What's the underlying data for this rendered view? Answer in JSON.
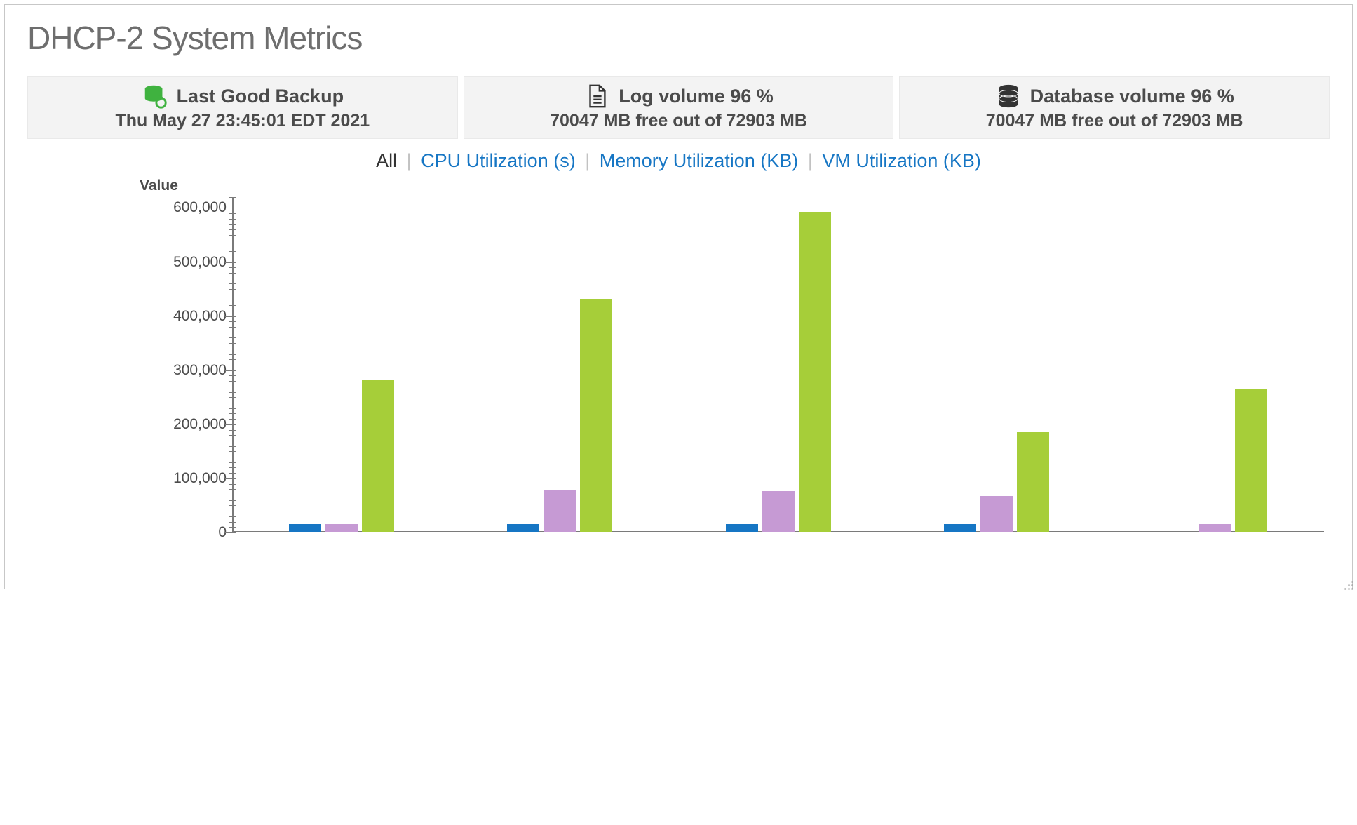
{
  "title": "DHCP-2 System Metrics",
  "cards": {
    "backup": {
      "label": "Last Good Backup",
      "detail": "Thu May 27 23:45:01 EDT 2021"
    },
    "log": {
      "label": "Log volume 96 %",
      "detail": "70047 MB free out of 72903 MB"
    },
    "db": {
      "label": "Database volume 96 %",
      "detail": "70047 MB free out of 72903 MB"
    }
  },
  "tabs": {
    "all": "All",
    "cpu": "CPU Utilization (s)",
    "mem": "Memory Utilization (KB)",
    "vm": "VM Utilization (KB)",
    "active": "all"
  },
  "axis": {
    "ylabel": "Value",
    "yticks": [
      0,
      100000,
      200000,
      300000,
      400000,
      500000,
      600000
    ],
    "ymax": 620000
  },
  "chart_data": {
    "type": "bar",
    "title": "DHCP-2 System Metrics",
    "ylabel": "Value",
    "ylim": [
      0,
      620000
    ],
    "categories": [
      "",
      "",
      "",
      "",
      ""
    ],
    "series": [
      {
        "name": "CPU Utilization (s)",
        "color": "#1676c4",
        "values": [
          16000,
          16000,
          16000,
          16000,
          0
        ]
      },
      {
        "name": "Memory Utilization (KB)",
        "color": "#c69ad4",
        "values": [
          16000,
          78000,
          76000,
          67000,
          16000
        ]
      },
      {
        "name": "VM Utilization (KB)",
        "color": "#a6ce39",
        "values": [
          283000,
          432000,
          593000,
          185000,
          264000
        ]
      }
    ]
  }
}
